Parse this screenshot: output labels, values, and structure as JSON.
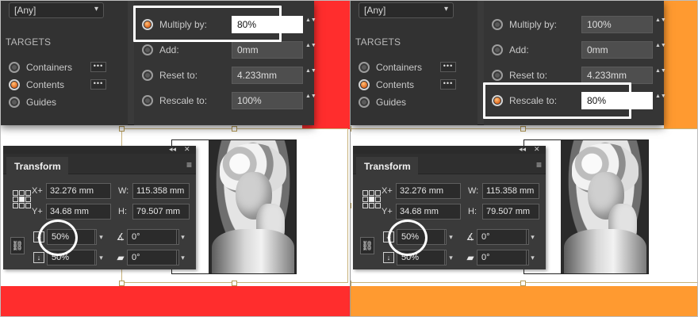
{
  "left_example": {
    "accent_color": "#ff2d2d",
    "rescale": {
      "filter_value": "[Any]",
      "targets_title": "TARGETS",
      "targets": [
        {
          "label": "Containers",
          "selected": false,
          "more": "•••"
        },
        {
          "label": "Contents",
          "selected": true,
          "more": "•••"
        },
        {
          "label": "Guides",
          "selected": false
        }
      ],
      "operations": [
        {
          "label": "Multiply by:",
          "value": "80%",
          "selected": true
        },
        {
          "label": "Add:",
          "value": "0mm",
          "selected": false
        },
        {
          "label": "Reset to:",
          "value": "4.233mm",
          "selected": false
        },
        {
          "label": "Rescale to:",
          "value": "100%",
          "selected": false
        }
      ]
    },
    "transform": {
      "tab": "Transform",
      "x_label": "X+",
      "x_value": "32.276 mm",
      "y_label": "Y+",
      "y_value": "34.68 mm",
      "w_label": "W:",
      "w_value": "115.358 mm",
      "h_label": "H:",
      "h_value": "79.507 mm",
      "scale_x": "50%",
      "scale_y": "50%",
      "rotation": "0°",
      "shear": "0°"
    }
  },
  "right_example": {
    "accent_color": "#ff9a30",
    "rescale": {
      "filter_value": "[Any]",
      "targets_title": "TARGETS",
      "targets": [
        {
          "label": "Containers",
          "selected": false,
          "more": "•••"
        },
        {
          "label": "Contents",
          "selected": true,
          "more": "•••"
        },
        {
          "label": "Guides",
          "selected": false
        }
      ],
      "operations": [
        {
          "label": "Multiply by:",
          "value": "100%",
          "selected": false
        },
        {
          "label": "Add:",
          "value": "0mm",
          "selected": false
        },
        {
          "label": "Reset to:",
          "value": "4.233mm",
          "selected": false
        },
        {
          "label": "Rescale to:",
          "value": "80%",
          "selected": true
        }
      ]
    },
    "transform": {
      "tab": "Transform",
      "x_label": "X+",
      "x_value": "32.276 mm",
      "y_label": "Y+",
      "y_value": "34.68 mm",
      "w_label": "W:",
      "w_value": "115.358 mm",
      "h_label": "H:",
      "h_value": "79.507 mm",
      "scale_x": "50%",
      "scale_y": "50%",
      "rotation": "0°",
      "shear": "0°"
    }
  },
  "icons": {
    "dropdown_caret": "▾",
    "spin": "▲▼",
    "close": "✕",
    "collapse": "◂◂",
    "panel_menu": "≡",
    "chain": "⛓",
    "scale_x": "⇔",
    "scale_y": "↓",
    "rotate": "∡",
    "shear": "▰"
  }
}
